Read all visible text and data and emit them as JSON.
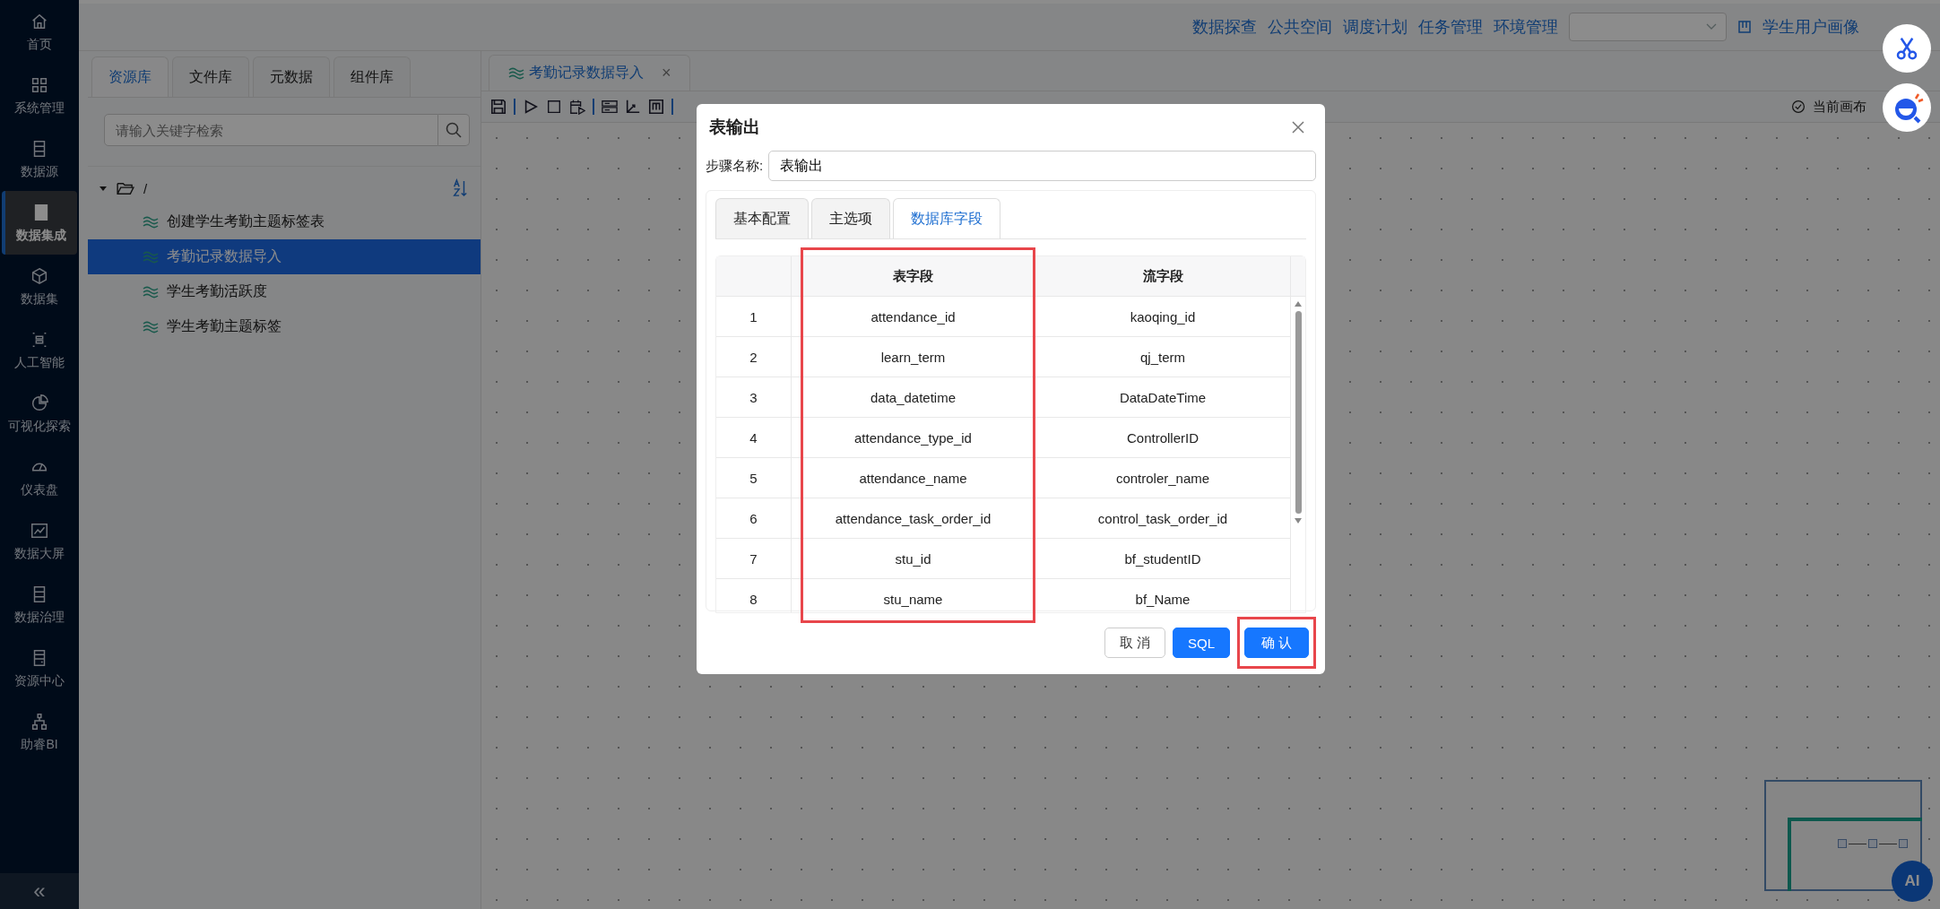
{
  "sidebar": {
    "items": [
      {
        "label": "首页",
        "selected": false
      },
      {
        "label": "系统管理",
        "selected": false
      },
      {
        "label": "数据源",
        "selected": false
      },
      {
        "label": "数据集成",
        "selected": true
      },
      {
        "label": "数据集",
        "selected": false
      },
      {
        "label": "人工智能",
        "selected": false
      },
      {
        "label": "可视化探索",
        "selected": false
      },
      {
        "label": "仪表盘",
        "selected": false
      },
      {
        "label": "数据大屏",
        "selected": false
      },
      {
        "label": "数据治理",
        "selected": false
      },
      {
        "label": "资源中心",
        "selected": false
      },
      {
        "label": "助睿BI",
        "selected": false
      }
    ],
    "collapse": "«"
  },
  "top_nav": {
    "links": [
      "数据探查",
      "公共空间",
      "调度计划",
      "任务管理",
      "环境管理"
    ],
    "project": "学生用户画像"
  },
  "left_panel": {
    "tabs": [
      {
        "label": "资源库",
        "selected": true
      },
      {
        "label": "文件库",
        "selected": false
      },
      {
        "label": "元数据",
        "selected": false
      },
      {
        "label": "组件库",
        "selected": false
      }
    ],
    "search": {
      "placeholder": "请输入关键字检索"
    },
    "tree": {
      "label": "/",
      "expanded": true,
      "children": [
        {
          "label": "创建学生考勤主题标签表",
          "selected": false
        },
        {
          "label": "考勤记录数据导入",
          "selected": true
        },
        {
          "label": "学生考勤活跃度",
          "selected": false
        },
        {
          "label": "学生考勤主题标签",
          "selected": false
        }
      ]
    }
  },
  "editor": {
    "tab": {
      "label": "考勤记录数据导入",
      "close": "×"
    },
    "canvas_status": "当前画布"
  },
  "minimap": {
    "ai_button": "AI"
  },
  "dialog": {
    "title": "表输出",
    "step_name": {
      "label": "步骤名称:",
      "value": "表输出"
    },
    "tabs": [
      {
        "label": "基本配置",
        "selected": false
      },
      {
        "label": "主选项",
        "selected": false
      },
      {
        "label": "数据库字段",
        "selected": true
      }
    ],
    "table": {
      "columns": [
        "表字段",
        "流字段"
      ],
      "rows": [
        {
          "index": "1",
          "table_field": "attendance_id",
          "stream_field": "kaoqing_id"
        },
        {
          "index": "2",
          "table_field": "learn_term",
          "stream_field": "qj_term"
        },
        {
          "index": "3",
          "table_field": "data_datetime",
          "stream_field": "DataDateTime"
        },
        {
          "index": "4",
          "table_field": "attendance_type_id",
          "stream_field": "ControllerID"
        },
        {
          "index": "5",
          "table_field": "attendance_name",
          "stream_field": "controler_name"
        },
        {
          "index": "6",
          "table_field": "attendance_task_order_id",
          "stream_field": "control_task_order_id"
        },
        {
          "index": "7",
          "table_field": "stu_id",
          "stream_field": "bf_studentID"
        },
        {
          "index": "8",
          "table_field": "stu_name",
          "stream_field": "bf_Name"
        }
      ]
    },
    "buttons": [
      {
        "label": "取 消",
        "kind": "default",
        "highlighted": false
      },
      {
        "label": "SQL",
        "kind": "primary",
        "highlighted": false
      },
      {
        "label": "确 认",
        "kind": "primary",
        "highlighted": true
      }
    ]
  }
}
